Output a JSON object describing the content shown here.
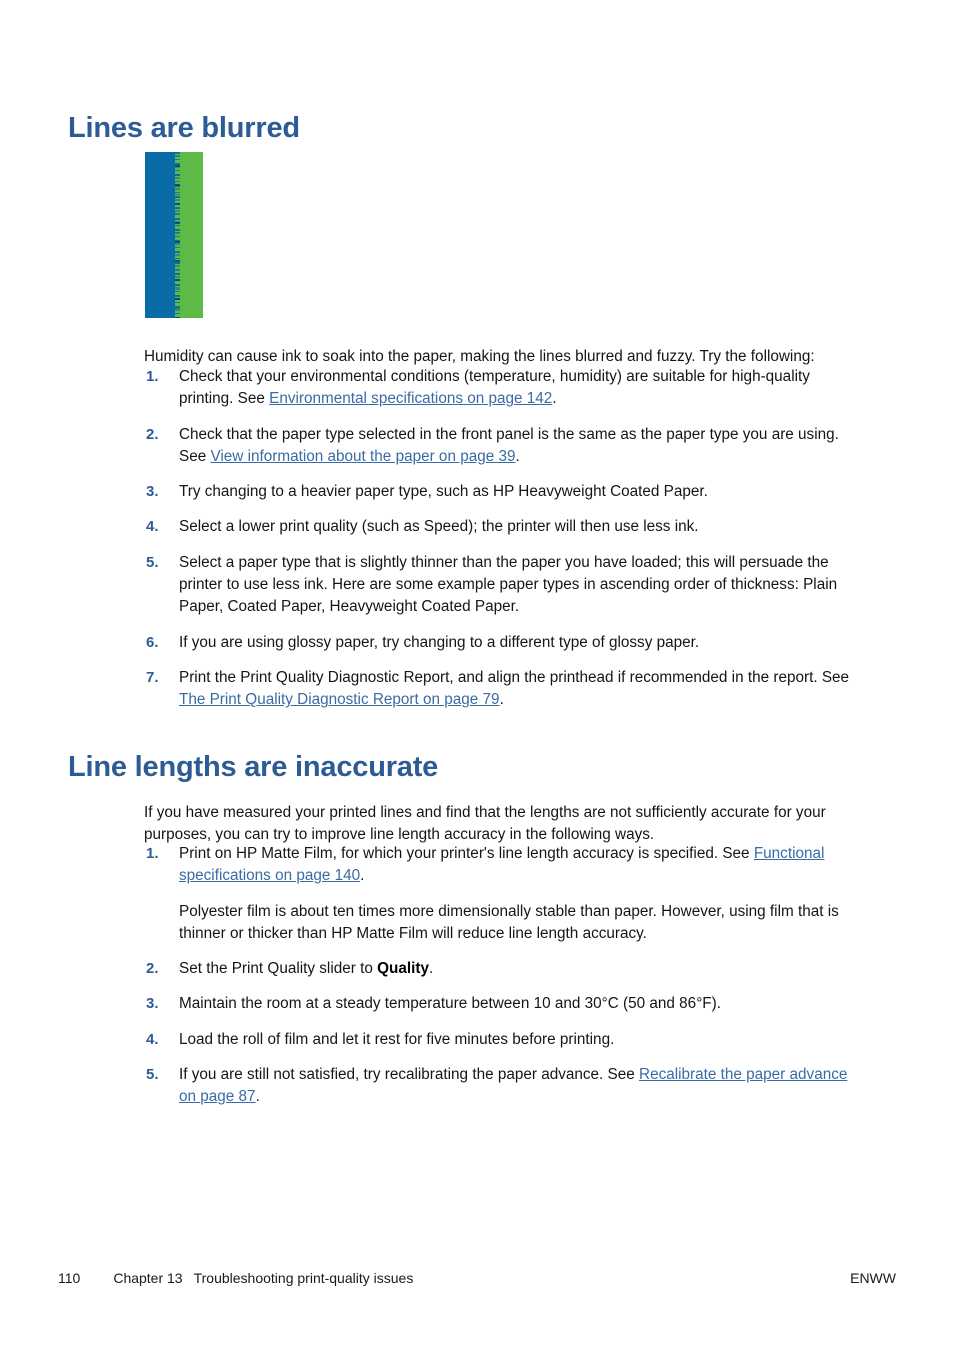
{
  "page": {
    "number": "110",
    "chapter_label": "Chapter 13",
    "chapter_title": "Troubleshooting print-quality issues",
    "locale_code": "ENWW"
  },
  "colors": {
    "heading_blue": "#2d5b96",
    "link_blue": "#3a6ba5",
    "figure_ink_blue": "#0a6ca6",
    "figure_ink_green": "#5cba46",
    "body_text": "#151515"
  },
  "sections": [
    {
      "heading": "Lines are blurred",
      "figure": {
        "alt": "Printed sample showing a blue block abutting a green block with a blurred, fuzzy boundary",
        "left_color_name": "ink-blue",
        "right_color_name": "ink-green"
      },
      "intro": "Humidity can cause ink to soak into the paper, making the lines blurred and fuzzy. Try the following:",
      "items": [
        {
          "number": "1.",
          "pre": "Check that your environmental conditions (temperature, humidity) are suitable for high-quality printing. See ",
          "link": "Environmental specifications on page 142",
          "post": "."
        },
        {
          "number": "2.",
          "pre": "Check that the paper type selected in the front panel is the same as the paper type you are using. See ",
          "link": "View information about the paper on page 39",
          "post": "."
        },
        {
          "number": "3.",
          "pre": "Try changing to a heavier paper type, such as HP Heavyweight Coated Paper.",
          "link": "",
          "post": ""
        },
        {
          "number": "4.",
          "pre": "Select a lower print quality (such as Speed); the printer will then use less ink.",
          "link": "",
          "post": ""
        },
        {
          "number": "5.",
          "pre": "Select a paper type that is slightly thinner than the paper you have loaded; this will persuade the printer to use less ink. Here are some example paper types in ascending order of thickness: Plain Paper, Coated Paper, Heavyweight Coated Paper.",
          "link": "",
          "post": ""
        },
        {
          "number": "6.",
          "pre": "If you are using glossy paper, try changing to a different type of glossy paper.",
          "link": "",
          "post": ""
        },
        {
          "number": "7.",
          "pre": "Print the Print Quality Diagnostic Report, and align the printhead if recommended in the report. See ",
          "link": "The Print Quality Diagnostic Report on page 79",
          "post": "."
        }
      ]
    },
    {
      "heading": "Line lengths are inaccurate",
      "intro": "If you have measured your printed lines and find that the lengths are not sufficiently accurate for your purposes, you can try to improve line length accuracy in the following ways.",
      "items": [
        {
          "number": "1.",
          "pre": "Print on HP Matte Film, for which your printer's line length accuracy is specified. See ",
          "link": "Functional specifications on page 140",
          "post": "."
        },
        {
          "number": "2.",
          "pre": "Set the Print Quality slider to ",
          "bold": "Quality",
          "post": "."
        },
        {
          "number": "3.",
          "pre": "Maintain the room at a steady temperature between 10 and 30°C (50 and 86°F).",
          "link": "",
          "post": ""
        },
        {
          "number": "4.",
          "pre": "Load the roll of film and let it rest for five minutes before printing.",
          "link": "",
          "post": ""
        },
        {
          "number": "5.",
          "pre": "If you are still not satisfied, try recalibrating the paper advance. See ",
          "link": "Recalibrate the paper advance on page 87",
          "post": "."
        }
      ],
      "sub_paragraph": "Polyester film is about ten times more dimensionally stable than paper. However, using film that is thinner or thicker than HP Matte Film will reduce line length accuracy."
    }
  ]
}
